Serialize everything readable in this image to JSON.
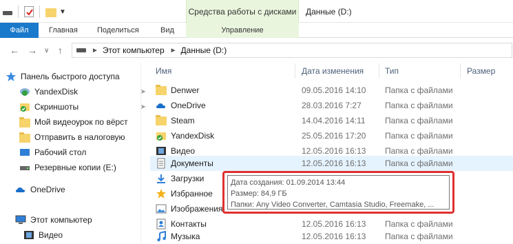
{
  "window": {
    "title": "Данные (D:)",
    "context_group_title": "Средства работы с дисками"
  },
  "ribbon": {
    "tabs": [
      {
        "label": "Файл"
      },
      {
        "label": "Главная"
      },
      {
        "label": "Поделиться"
      },
      {
        "label": "Вид"
      },
      {
        "label": "Управление"
      }
    ]
  },
  "address": {
    "crumbs": [
      "Этот компьютер",
      "Данные (D:)"
    ]
  },
  "nav": {
    "items": [
      {
        "label": "Панель быстрого доступа",
        "icon": "star-icon"
      },
      {
        "label": "YandexDisk",
        "icon": "yandexdisk-icon",
        "pinned": true
      },
      {
        "label": "Скриншоты",
        "icon": "screenshots-icon",
        "pinned": true
      },
      {
        "label": "Мой видеоурок по вёрст",
        "icon": "folder-icon"
      },
      {
        "label": "Отправить в налоговую",
        "icon": "folder-icon"
      },
      {
        "label": "Рабочий стол",
        "icon": "desktop-icon"
      },
      {
        "label": "Резервные копии (E:)",
        "icon": "drive-icon"
      },
      {
        "label": "OneDrive",
        "icon": "onedrive-icon"
      },
      {
        "label": "Этот компьютер",
        "icon": "computer-icon"
      },
      {
        "label": "Видео",
        "icon": "video-icon"
      }
    ]
  },
  "columns": {
    "name": "Имя",
    "date": "Дата изменения",
    "type": "Тип",
    "size": "Размер"
  },
  "files": [
    {
      "name": "Denwer",
      "date": "09.05.2016 14:10",
      "type": "Папка с файлами",
      "icon": "folder-icon"
    },
    {
      "name": "OneDrive",
      "date": "28.03.2016 7:27",
      "type": "Папка с файлами",
      "icon": "onedrive-icon"
    },
    {
      "name": "Steam",
      "date": "14.04.2016 14:11",
      "type": "Папка с файлами",
      "icon": "folder-icon"
    },
    {
      "name": "YandexDisk",
      "date": "25.05.2016 17:20",
      "type": "Папка с файлами",
      "icon": "yandexdisk-icon"
    },
    {
      "name": "Видео",
      "date": "12.05.2016 16:13",
      "type": "Папка с файлами",
      "icon": "video-icon"
    },
    {
      "name": "Документы",
      "date": "12.05.2016 16:13",
      "type": "Папка с файлами",
      "icon": "documents-icon"
    },
    {
      "name": "Загрузки",
      "date": "",
      "type": "",
      "icon": "downloads-icon"
    },
    {
      "name": "Избранное",
      "date": "",
      "type": "",
      "icon": "favorites-icon"
    },
    {
      "name": "Изображения",
      "date": "",
      "type": "",
      "icon": "pictures-icon"
    },
    {
      "name": "Контакты",
      "date": "12.05.2016 16:13",
      "type": "Папка с файлами",
      "icon": "contacts-icon"
    },
    {
      "name": "Музыка",
      "date": "12.05.2016 16:13",
      "type": "Папка с файлами",
      "icon": "music-icon"
    }
  ],
  "tooltip": {
    "created": "Дата создания: 01.09.2014 13:44",
    "size": "Размер: 84,9 ГБ",
    "folders": "Папки: Any Video Converter, Camtasia Studio, Freemake, ..."
  },
  "colors": {
    "accent": "#1979ca",
    "context_tab": "#e9f5dd",
    "hover_row": "#e5f3ff",
    "highlight_border": "#e0302f"
  }
}
